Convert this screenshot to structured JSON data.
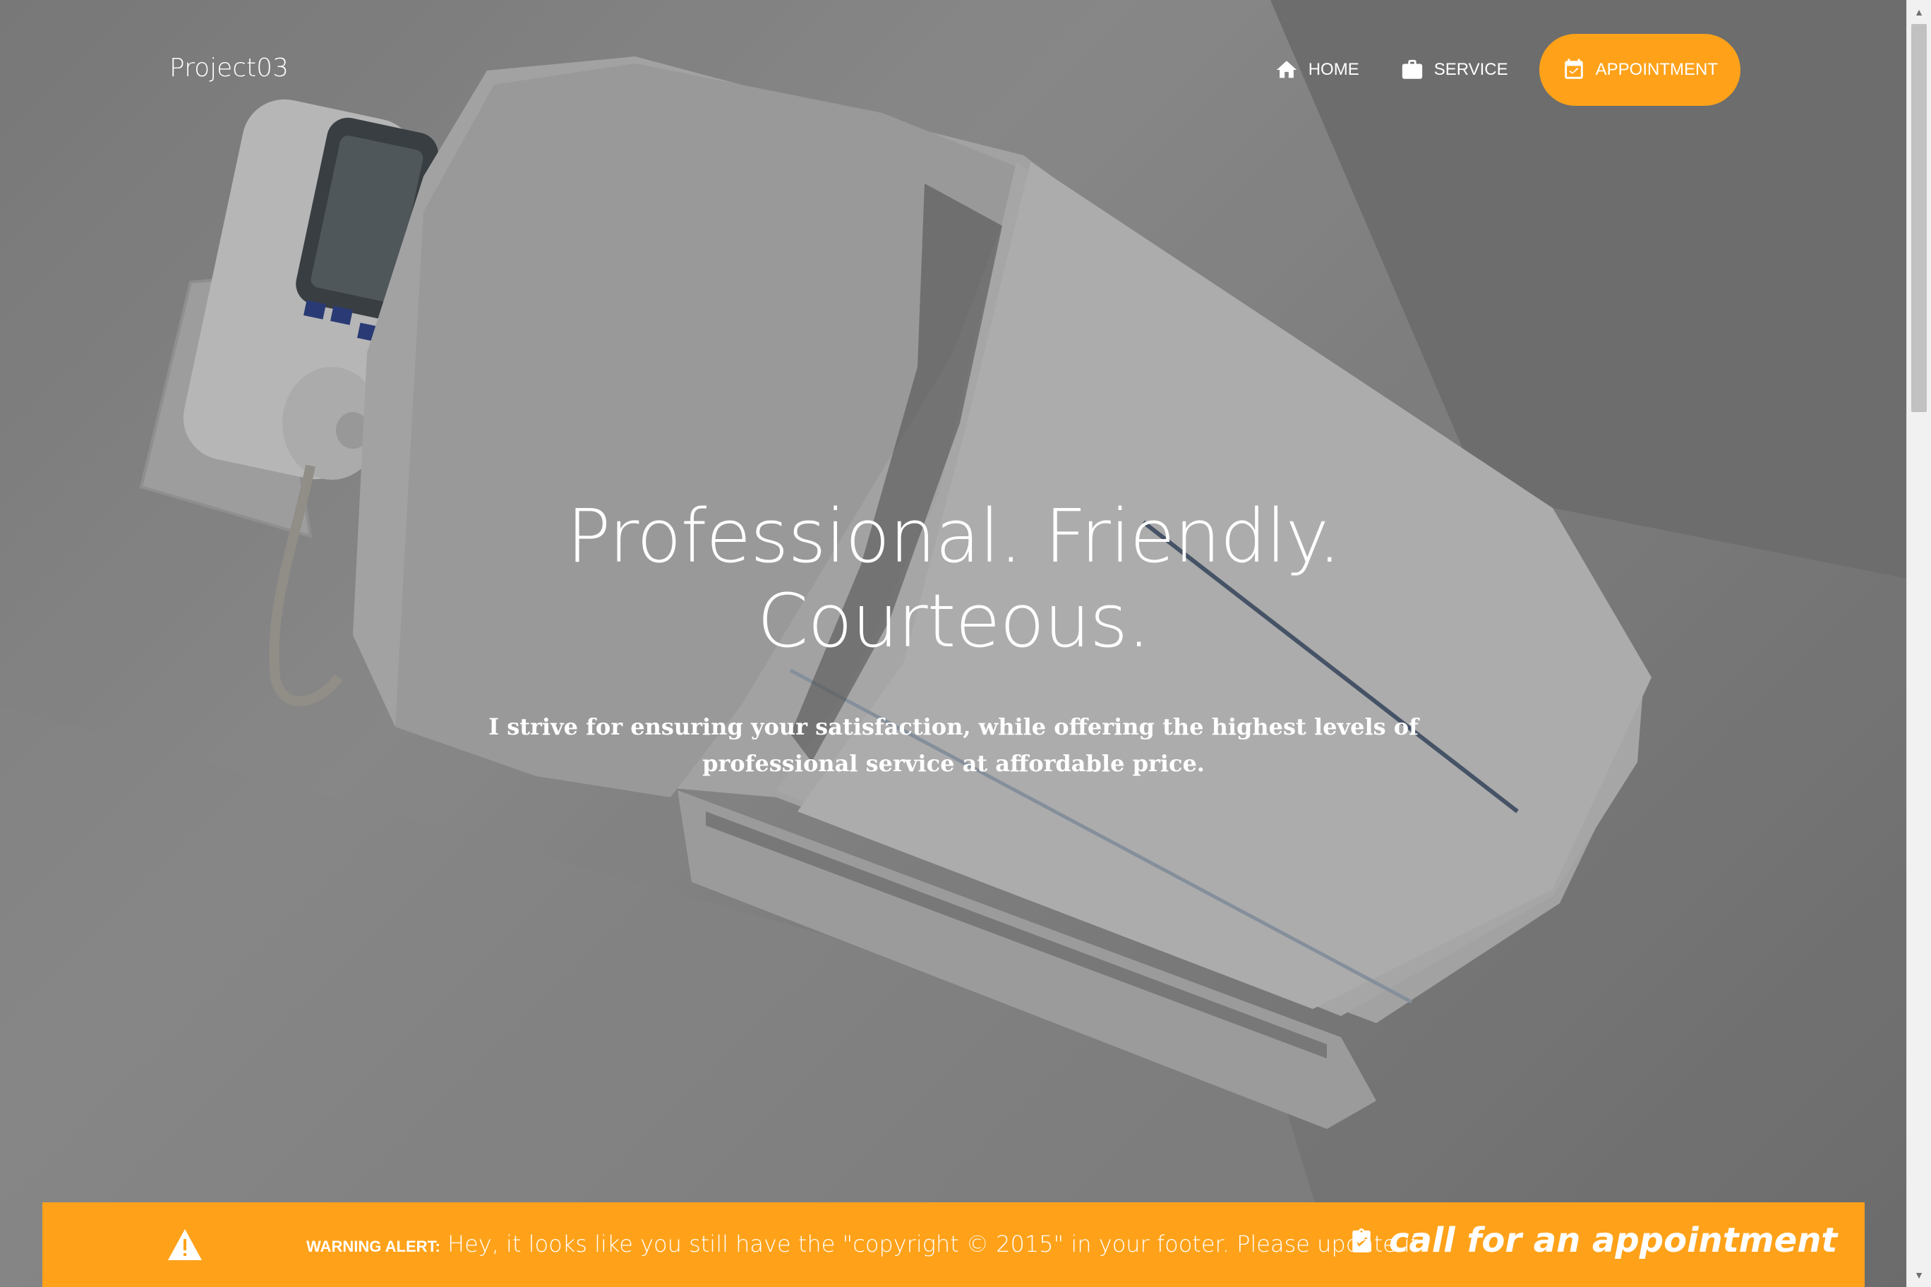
{
  "navbar": {
    "brand": "Project03",
    "items": [
      {
        "label": "HOME",
        "icon": "home-icon"
      },
      {
        "label": "SERVICE",
        "icon": "briefcase-icon"
      },
      {
        "label": "APPOINTMENT",
        "icon": "calendar-check-icon"
      }
    ]
  },
  "hero": {
    "title_line1": "Professional. Friendly.",
    "title_line2": "Courteous.",
    "subtitle": "I strive for ensuring your satisfaction, while offering the highest levels of professional service at affordable price."
  },
  "alert": {
    "icon": "warning-icon",
    "label": "WARNING ALERT:",
    "message": "Hey, it looks like you still have the \"copyright © 2015\" in your footer. Please update it!",
    "call_icon": "clipboard-check-icon",
    "call_text": "call for an appointment"
  },
  "colors": {
    "accent": "#ffa21a",
    "text": "#ffffff"
  }
}
